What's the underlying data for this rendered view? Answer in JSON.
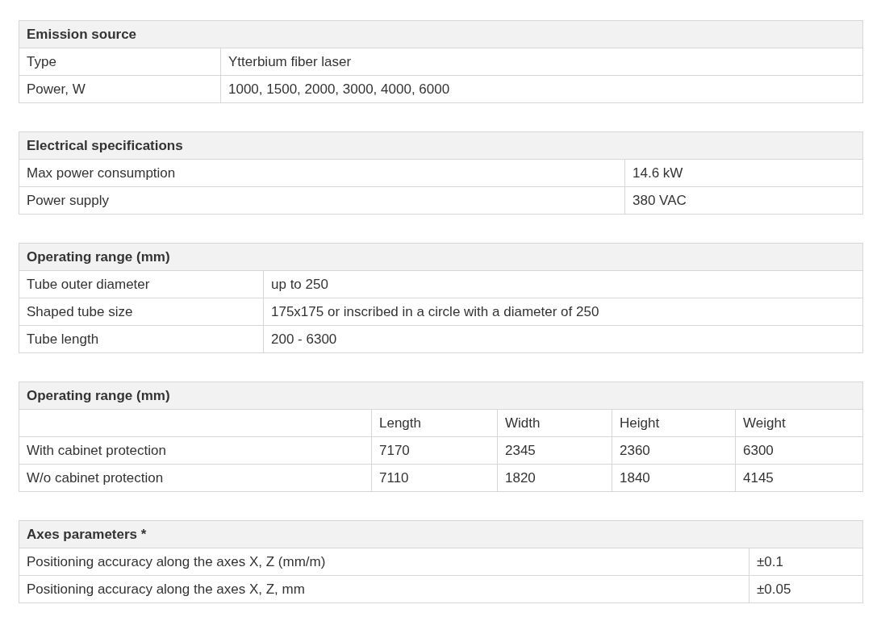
{
  "tables": [
    {
      "title": "Emission source",
      "rows": [
        [
          "Type",
          "Ytterbium fiber laser"
        ],
        [
          "Power, W",
          "1000, 1500, 2000, 3000, 4000, 6000"
        ]
      ]
    },
    {
      "title": "Electrical specifications",
      "rows": [
        [
          "Max power consumption",
          "14.6 kW"
        ],
        [
          "Power supply",
          "380 VAC"
        ]
      ]
    },
    {
      "title": "Operating range (mm)",
      "rows": [
        [
          "Tube outer diameter",
          "up to 250"
        ],
        [
          "Shaped tube size",
          "175x175 or inscribed in a circle with a diameter of 250"
        ],
        [
          "Tube length",
          "200 - 6300"
        ]
      ]
    },
    {
      "title": "Operating range (mm)",
      "columns": [
        "",
        "Length",
        "Width",
        "Height",
        "Weight"
      ],
      "rows": [
        [
          "With cabinet protection",
          "7170",
          "2345",
          "2360",
          "6300"
        ],
        [
          "W/o cabinet protection",
          "7110",
          "1820",
          "1840",
          "4145"
        ]
      ]
    },
    {
      "title": "Axes parameters *",
      "rows": [
        [
          "Positioning accuracy along the axes X, Z (mm/m)",
          "±0.1"
        ],
        [
          "Positioning accuracy along the axes X, Z, mm",
          "±0.05"
        ]
      ]
    }
  ]
}
